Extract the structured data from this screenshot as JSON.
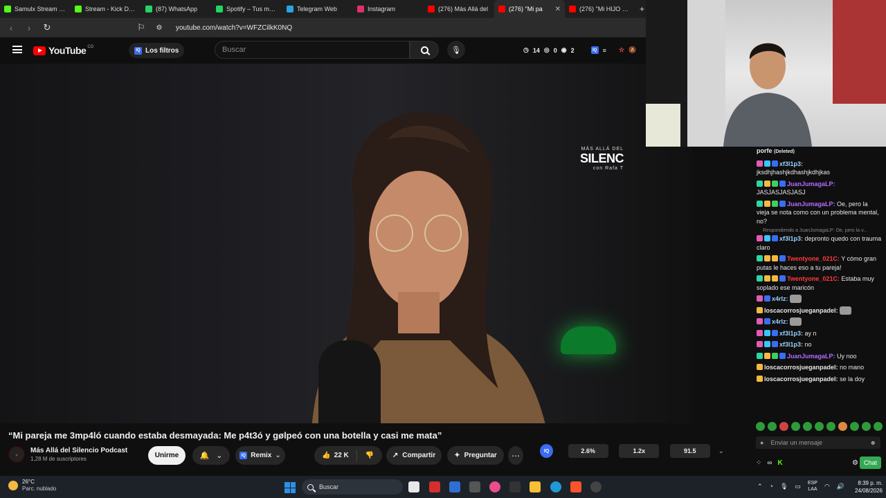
{
  "tabs": [
    {
      "title": "Samulx Stream - W",
      "favicon_color": "#53fc18",
      "active": false
    },
    {
      "title": "Stream - Kick Dashb",
      "favicon_color": "#53fc18",
      "active": false
    },
    {
      "title": "(87) WhatsApp",
      "favicon_color": "#25d366",
      "active": false
    },
    {
      "title": "Spotify – Tus me gu",
      "favicon_color": "#1ed760",
      "active": false
    },
    {
      "title": "Telegram Web",
      "favicon_color": "#2aa4e0",
      "active": false
    },
    {
      "title": "Instagram",
      "favicon_color": "#e1306c",
      "active": false
    },
    {
      "title": "(276) Más Allá del",
      "favicon_color": "#ff0000",
      "active": false
    },
    {
      "title": "(276) \"Mi pa",
      "favicon_color": "#ff0000",
      "active": true
    },
    {
      "title": "(276) \"Mi HIJO D3S",
      "favicon_color": "#ff0000",
      "active": false
    }
  ],
  "new_tab_label": "+",
  "address": {
    "url": "youtube.com/watch?v=WFZCilkK0NQ"
  },
  "header": {
    "logo_text": "YouTube",
    "logo_country": "CO",
    "filters_label": "Los filtros",
    "search_placeholder": "Buscar",
    "stats": {
      "clock_count": "14",
      "views_count": "0",
      "eye_count": "2"
    }
  },
  "video": {
    "watermark_small": "MÁS ALLÁ DEL",
    "watermark_big": "SILENC",
    "watermark_sub": "con Rafa T"
  },
  "title": "“Mi pareja me 3mp4ló cuando estaba desmayada: Me p4t3ó y gølpeó con una botella y casi me mata”",
  "channel": {
    "name": "Más Allá del Silencio Podcast",
    "subscribers": "1,28 M de suscriptores",
    "join_label": "Unirme",
    "remix_label": "Remix",
    "likes": "22 K",
    "share_label": "Compartir",
    "ask_label": "Preguntar"
  },
  "ext_stats": {
    "a": "2.6%",
    "b": "1.2x",
    "c": "91.5"
  },
  "chat": {
    "messages": [
      {
        "user": "porfe",
        "text": "(Deleted)",
        "user_color": "#e8e8e8",
        "badges": []
      },
      {
        "user": "xf3l1p3:",
        "text": "jksdhjhashjkdhashjkdhjkas",
        "user_color": "#9ad0ff",
        "badges": [
          "#e25bb5",
          "#39c5ff",
          "#3a6df0"
        ],
        "newline": true
      },
      {
        "user": "JuanJumagaLP:",
        "text": "JASJASJASJASJ",
        "user_color": "#b26bff",
        "badges": [
          "#2fd6a0",
          "#f5b941",
          "#3fcf5f",
          "#3a6df0"
        ],
        "newline": true
      },
      {
        "user": "JuanJumagaLP:",
        "text": "Oe, pero la vieja se nota como con un problema mental, no?",
        "user_color": "#b26bff",
        "badges": [
          "#2fd6a0",
          "#f5b941",
          "#3fcf5f",
          "#3a6df0"
        ]
      },
      {
        "reply": "Respondiendo a JuanJumagaLP: Oe, pero la v..."
      },
      {
        "user": "xf3l1p3:",
        "text": "depronto quedo con trauma claro",
        "user_color": "#9ad0ff",
        "badges": [
          "#e25bb5",
          "#39c5ff",
          "#3a6df0"
        ]
      },
      {
        "user": "Twentyone_021C:",
        "text": "Y cómo gran putas le haces eso a tu pareja!",
        "user_color": "#ff3a3a",
        "badges": [
          "#2fd6a0",
          "#f5b941",
          "#f5b941",
          "#3a6df0"
        ]
      },
      {
        "user": "Twentyone_021C:",
        "text": "Estaba muy soplado ese maricón",
        "user_color": "#ff3a3a",
        "badges": [
          "#2fd6a0",
          "#f5b941",
          "#f5b941",
          "#3a6df0"
        ]
      },
      {
        "user": "x4rlz:",
        "text": "",
        "user_color": "#9ad0ff",
        "badges": [
          "#e25bb5",
          "#3a6df0"
        ],
        "emote": true
      },
      {
        "user": "loscacorrosjueganpadel:",
        "text": "",
        "user_color": "#e8e8e8",
        "badges": [
          "#f5b941"
        ],
        "emote": true
      },
      {
        "user": "x4rlz:",
        "text": "",
        "user_color": "#9ad0ff",
        "badges": [
          "#e25bb5",
          "#3a6df0"
        ],
        "emote": true
      },
      {
        "user": "xf3l1p3:",
        "text": "ay n",
        "user_color": "#9ad0ff",
        "badges": [
          "#e25bb5",
          "#39c5ff",
          "#3a6df0"
        ]
      },
      {
        "user": "xf3l1p3:",
        "text": "no",
        "user_color": "#9ad0ff",
        "badges": [
          "#e25bb5",
          "#39c5ff",
          "#3a6df0"
        ]
      },
      {
        "user": "JuanJumagaLP:",
        "text": "Uy noo",
        "user_color": "#b26bff",
        "badges": [
          "#2fd6a0",
          "#f5b941",
          "#3fcf5f",
          "#3a6df0"
        ]
      },
      {
        "user": "loscacorrosjueganpadel:",
        "text": "no mano",
        "user_color": "#e8e8e8",
        "badges": [
          "#f5b941"
        ]
      },
      {
        "user": "loscacorrosjueganpadel:",
        "text": "se la doy",
        "user_color": "#e8e8e8",
        "badges": [
          "#f5b941"
        ]
      }
    ],
    "input_placeholder": "Enviar un mensaje",
    "chat_button": "Chat"
  },
  "taskbar": {
    "temperature": "26°C",
    "weather": "Parc. nublado",
    "search_label": "Buscar",
    "lang": "ESP",
    "lang_sub": "LAA",
    "time": "8:39 p. m.",
    "date": "24/08/2026"
  }
}
